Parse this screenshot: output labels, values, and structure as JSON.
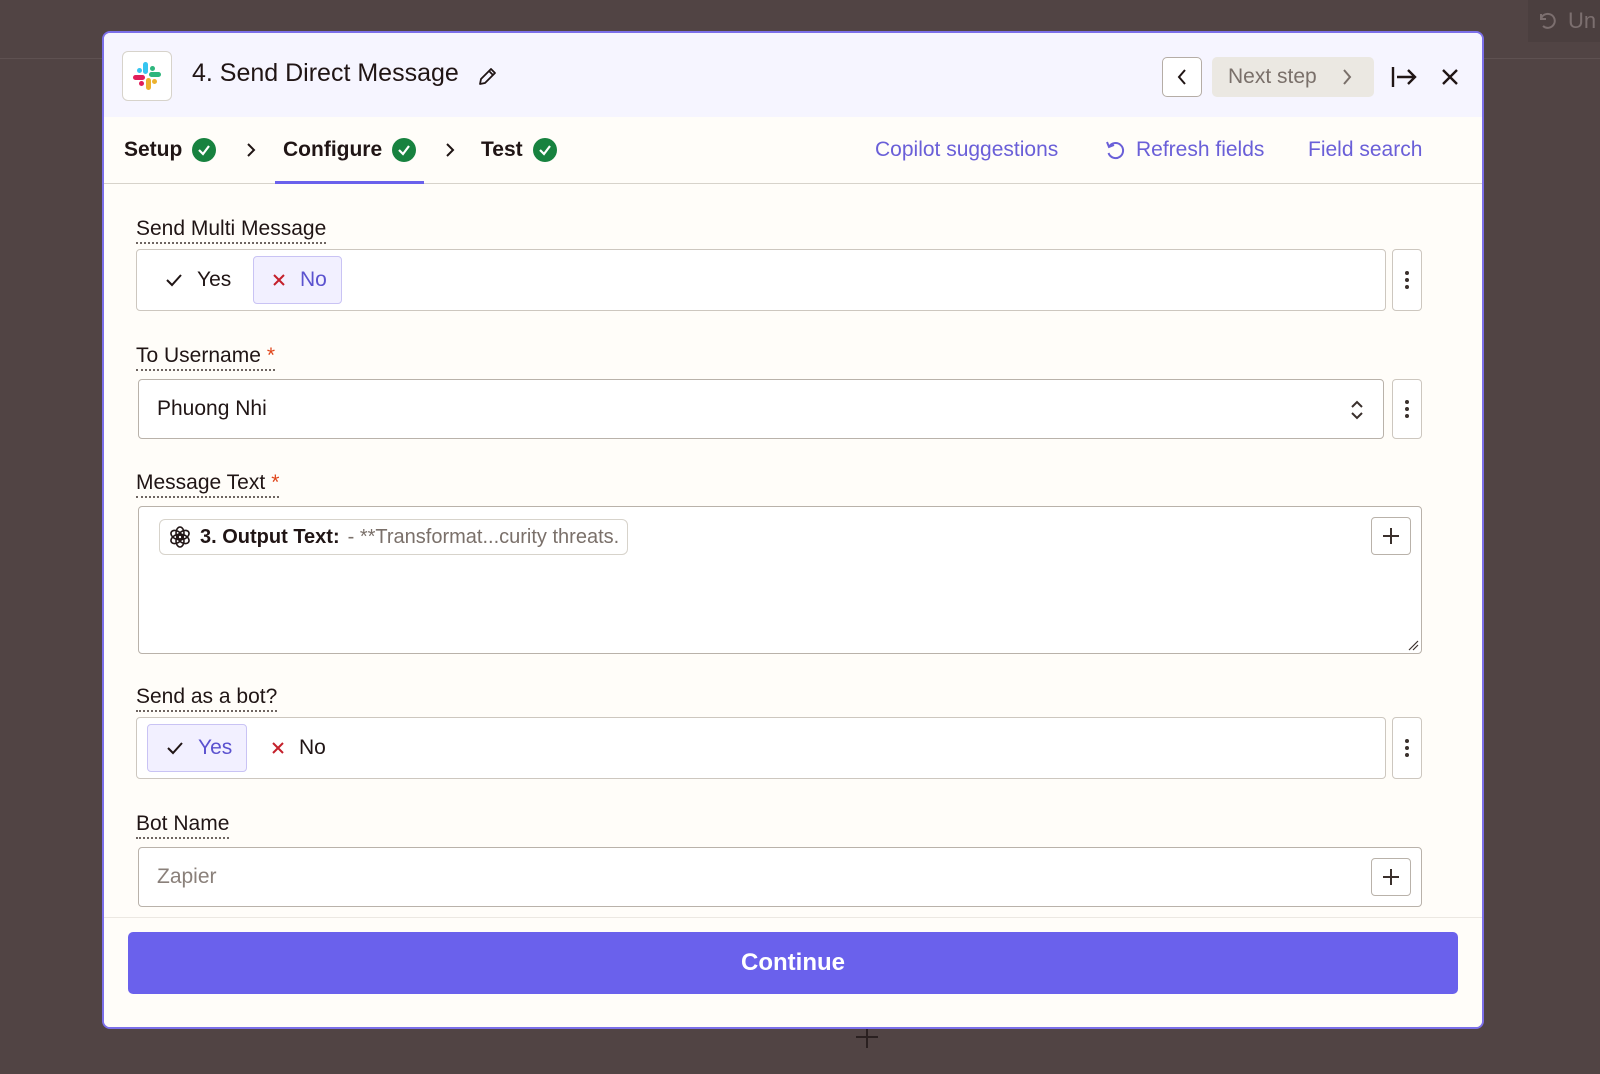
{
  "background": {
    "undo_label": "Un"
  },
  "header": {
    "step_title": "4. Send Direct Message",
    "next_step_label": "Next step"
  },
  "tabs": [
    {
      "label": "Setup",
      "complete": true
    },
    {
      "label": "Configure",
      "complete": true,
      "active": true
    },
    {
      "label": "Test",
      "complete": true
    }
  ],
  "actions": {
    "copilot": "Copilot suggestions",
    "refresh": "Refresh fields",
    "field_search": "Field search"
  },
  "fields": {
    "send_multi": {
      "label": "Send Multi Message",
      "yes": "Yes",
      "no": "No",
      "selected": "No"
    },
    "to_username": {
      "label": "To Username",
      "required": "*",
      "value": "Phuong Nhi"
    },
    "message_text": {
      "label": "Message Text",
      "required": "*",
      "pill_label": "3. Output Text:",
      "pill_value": "- **Transformat...curity threats."
    },
    "send_as_bot": {
      "label": "Send as a bot?",
      "yes": "Yes",
      "no": "No",
      "selected": "Yes"
    },
    "bot_name": {
      "label": "Bot Name",
      "placeholder": "Zapier"
    }
  },
  "footer": {
    "continue_label": "Continue"
  },
  "colors": {
    "accent": "#6a61ec",
    "success": "#17823f",
    "required": "#e0461b",
    "backdrop": "#514444"
  },
  "icons": [
    "slack-icon",
    "edit-pencil-icon",
    "chevron-left-icon",
    "chevron-right-icon",
    "expand-panel-icon",
    "close-icon",
    "check-icon",
    "x-icon",
    "refresh-icon",
    "kebab-menu-icon",
    "select-arrows-icon",
    "openai-icon",
    "plus-icon",
    "undo-icon"
  ]
}
